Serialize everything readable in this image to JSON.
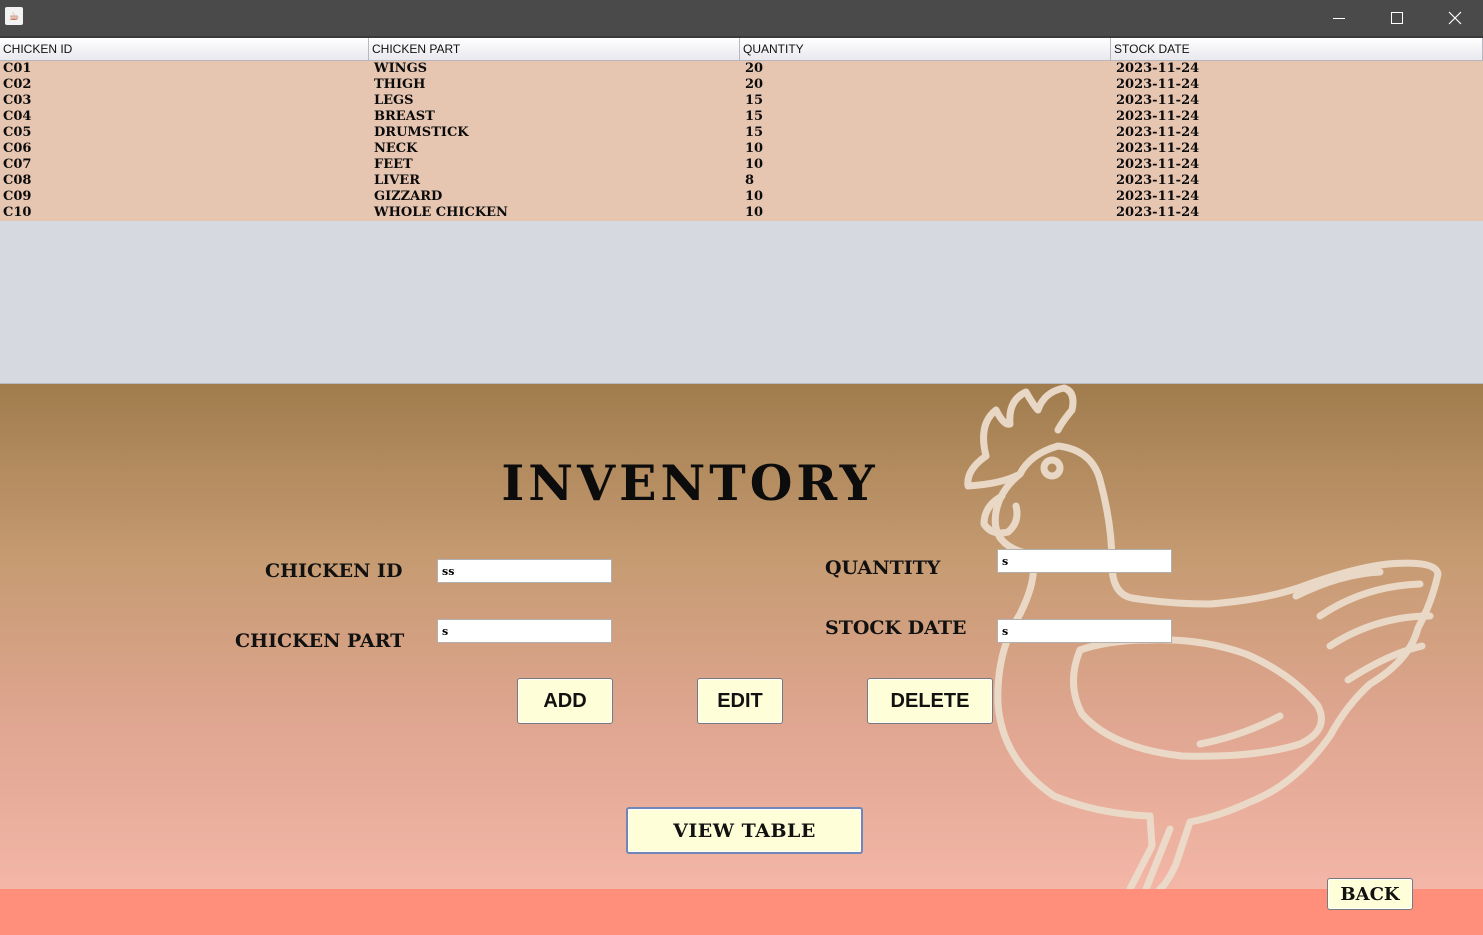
{
  "window": {
    "icon": "java-cup-icon",
    "controls": [
      "minimize-icon",
      "maximize-icon",
      "close-icon"
    ]
  },
  "table": {
    "columns": [
      "CHICKEN ID",
      "CHICKEN PART",
      "QUANTITY",
      "STOCK DATE"
    ],
    "rows": [
      [
        "C01",
        "WINGS",
        "20",
        "2023-11-24"
      ],
      [
        "C02",
        "THIGH",
        "20",
        "2023-11-24"
      ],
      [
        "C03",
        "LEGS",
        "15",
        "2023-11-24"
      ],
      [
        "C04",
        "BREAST",
        "15",
        "2023-11-24"
      ],
      [
        "C05",
        "DRUMSTICK",
        "15",
        "2023-11-24"
      ],
      [
        "C06",
        "NECK",
        "10",
        "2023-11-24"
      ],
      [
        "C07",
        "FEET",
        "10",
        "2023-11-24"
      ],
      [
        "C08",
        "LIVER",
        "8",
        "2023-11-24"
      ],
      [
        "C09",
        "GIZZARD",
        "10",
        "2023-11-24"
      ],
      [
        "C10",
        "WHOLE CHICKEN",
        "10",
        "2023-11-24"
      ]
    ]
  },
  "form": {
    "title": "INVENTORY",
    "labels": {
      "chicken_id": "CHICKEN ID",
      "chicken_part": "CHICKEN PART",
      "quantity": "QUANTITY",
      "stock_date": "STOCK DATE"
    },
    "values": {
      "chicken_id": "ss",
      "chicken_part": "s",
      "quantity": "s",
      "stock_date": "s"
    }
  },
  "buttons": {
    "add": "ADD",
    "edit": "EDIT",
    "delete": "DELETE",
    "view_table": "VIEW TABLE",
    "back": "BACK"
  },
  "colors": {
    "titlebar": "#4a4a4a",
    "table_row": "#e6c5b1",
    "table_empty": "#d7d9e1",
    "panel_top": "#a07c4d",
    "panel_bottom": "#f3b6a7",
    "footer": "#ff8f7a",
    "button": "#fefed8",
    "hen_outline": "#ecdccb"
  },
  "decoration": "hen-outline-illustration"
}
